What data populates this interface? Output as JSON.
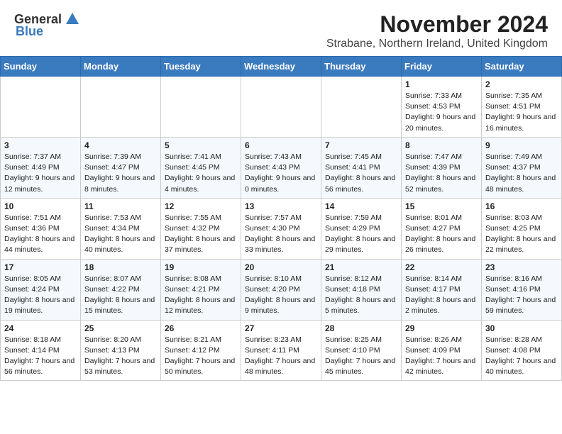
{
  "header": {
    "logo_general": "General",
    "logo_blue": "Blue",
    "month_title": "November 2024",
    "location": "Strabane, Northern Ireland, United Kingdom"
  },
  "weekdays": [
    "Sunday",
    "Monday",
    "Tuesday",
    "Wednesday",
    "Thursday",
    "Friday",
    "Saturday"
  ],
  "weeks": [
    [
      {
        "day": "",
        "info": ""
      },
      {
        "day": "",
        "info": ""
      },
      {
        "day": "",
        "info": ""
      },
      {
        "day": "",
        "info": ""
      },
      {
        "day": "",
        "info": ""
      },
      {
        "day": "1",
        "info": "Sunrise: 7:33 AM\nSunset: 4:53 PM\nDaylight: 9 hours and 20 minutes."
      },
      {
        "day": "2",
        "info": "Sunrise: 7:35 AM\nSunset: 4:51 PM\nDaylight: 9 hours and 16 minutes."
      }
    ],
    [
      {
        "day": "3",
        "info": "Sunrise: 7:37 AM\nSunset: 4:49 PM\nDaylight: 9 hours and 12 minutes."
      },
      {
        "day": "4",
        "info": "Sunrise: 7:39 AM\nSunset: 4:47 PM\nDaylight: 9 hours and 8 minutes."
      },
      {
        "day": "5",
        "info": "Sunrise: 7:41 AM\nSunset: 4:45 PM\nDaylight: 9 hours and 4 minutes."
      },
      {
        "day": "6",
        "info": "Sunrise: 7:43 AM\nSunset: 4:43 PM\nDaylight: 9 hours and 0 minutes."
      },
      {
        "day": "7",
        "info": "Sunrise: 7:45 AM\nSunset: 4:41 PM\nDaylight: 8 hours and 56 minutes."
      },
      {
        "day": "8",
        "info": "Sunrise: 7:47 AM\nSunset: 4:39 PM\nDaylight: 8 hours and 52 minutes."
      },
      {
        "day": "9",
        "info": "Sunrise: 7:49 AM\nSunset: 4:37 PM\nDaylight: 8 hours and 48 minutes."
      }
    ],
    [
      {
        "day": "10",
        "info": "Sunrise: 7:51 AM\nSunset: 4:36 PM\nDaylight: 8 hours and 44 minutes."
      },
      {
        "day": "11",
        "info": "Sunrise: 7:53 AM\nSunset: 4:34 PM\nDaylight: 8 hours and 40 minutes."
      },
      {
        "day": "12",
        "info": "Sunrise: 7:55 AM\nSunset: 4:32 PM\nDaylight: 8 hours and 37 minutes."
      },
      {
        "day": "13",
        "info": "Sunrise: 7:57 AM\nSunset: 4:30 PM\nDaylight: 8 hours and 33 minutes."
      },
      {
        "day": "14",
        "info": "Sunrise: 7:59 AM\nSunset: 4:29 PM\nDaylight: 8 hours and 29 minutes."
      },
      {
        "day": "15",
        "info": "Sunrise: 8:01 AM\nSunset: 4:27 PM\nDaylight: 8 hours and 26 minutes."
      },
      {
        "day": "16",
        "info": "Sunrise: 8:03 AM\nSunset: 4:25 PM\nDaylight: 8 hours and 22 minutes."
      }
    ],
    [
      {
        "day": "17",
        "info": "Sunrise: 8:05 AM\nSunset: 4:24 PM\nDaylight: 8 hours and 19 minutes."
      },
      {
        "day": "18",
        "info": "Sunrise: 8:07 AM\nSunset: 4:22 PM\nDaylight: 8 hours and 15 minutes."
      },
      {
        "day": "19",
        "info": "Sunrise: 8:08 AM\nSunset: 4:21 PM\nDaylight: 8 hours and 12 minutes."
      },
      {
        "day": "20",
        "info": "Sunrise: 8:10 AM\nSunset: 4:20 PM\nDaylight: 8 hours and 9 minutes."
      },
      {
        "day": "21",
        "info": "Sunrise: 8:12 AM\nSunset: 4:18 PM\nDaylight: 8 hours and 5 minutes."
      },
      {
        "day": "22",
        "info": "Sunrise: 8:14 AM\nSunset: 4:17 PM\nDaylight: 8 hours and 2 minutes."
      },
      {
        "day": "23",
        "info": "Sunrise: 8:16 AM\nSunset: 4:16 PM\nDaylight: 7 hours and 59 minutes."
      }
    ],
    [
      {
        "day": "24",
        "info": "Sunrise: 8:18 AM\nSunset: 4:14 PM\nDaylight: 7 hours and 56 minutes."
      },
      {
        "day": "25",
        "info": "Sunrise: 8:20 AM\nSunset: 4:13 PM\nDaylight: 7 hours and 53 minutes."
      },
      {
        "day": "26",
        "info": "Sunrise: 8:21 AM\nSunset: 4:12 PM\nDaylight: 7 hours and 50 minutes."
      },
      {
        "day": "27",
        "info": "Sunrise: 8:23 AM\nSunset: 4:11 PM\nDaylight: 7 hours and 48 minutes."
      },
      {
        "day": "28",
        "info": "Sunrise: 8:25 AM\nSunset: 4:10 PM\nDaylight: 7 hours and 45 minutes."
      },
      {
        "day": "29",
        "info": "Sunrise: 8:26 AM\nSunset: 4:09 PM\nDaylight: 7 hours and 42 minutes."
      },
      {
        "day": "30",
        "info": "Sunrise: 8:28 AM\nSunset: 4:08 PM\nDaylight: 7 hours and 40 minutes."
      }
    ]
  ]
}
